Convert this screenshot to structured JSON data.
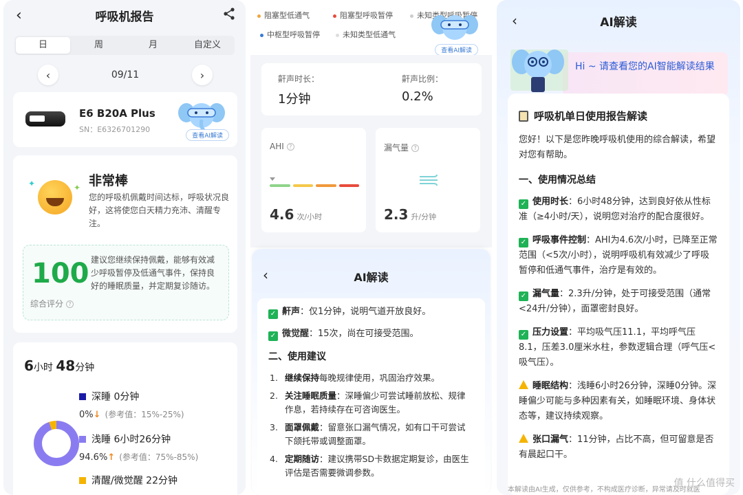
{
  "panel1": {
    "title": "呼吸机报告",
    "tabs": [
      "日",
      "周",
      "月",
      "自定义"
    ],
    "date": "09/11",
    "device": {
      "name": "E6 B20A Plus",
      "sn": "SN：E6326701290",
      "ai_button": "查看AI解读"
    },
    "verdict": {
      "title": "非常棒",
      "desc": "您的呼吸机佩戴时间达标，呼吸状况良好，这将使您白天精力充沛、清醒专注。"
    },
    "score": {
      "value": "100",
      "label": "综合评分",
      "advice": "建议您继续保持佩戴，能够有效减少呼吸暂停及低通气事件，保持良好的睡眠质量，并定期复诊随访。"
    },
    "sleep": {
      "hours": "6",
      "hours_unit": "小时",
      "minutes": "48",
      "minutes_unit": "分钟",
      "stages": [
        {
          "name": "深睡 0分钟",
          "pct": "0%",
          "trend": "down",
          "ref": "(参考值：15%-25%)",
          "color": "#1a1aa8"
        },
        {
          "name": "浅睡 6小时26分钟",
          "pct": "94.6%",
          "trend": "up",
          "ref": "(参考值：75%-85%)",
          "color": "#8a7cf0"
        },
        {
          "name": "清醒/微觉醒 22分钟",
          "color": "#f5b400"
        }
      ],
      "donut_fractions": [
        0.0,
        0.946,
        0.054
      ]
    }
  },
  "panel2": {
    "legend": [
      {
        "label": "阻塞型低通气",
        "color": "#f0a640"
      },
      {
        "label": "阻塞型呼吸暂停",
        "color": "#e84b3c"
      },
      {
        "label": "未知类型呼吸暂停",
        "color": "#cccccc"
      },
      {
        "label": "中枢型呼吸暂停",
        "color": "#3a7bd5"
      },
      {
        "label": "未知类型低通气",
        "color": "#dddddd"
      }
    ],
    "ai_button": "查看AI解读",
    "snore_time_label": "鼾声时长：",
    "snore_time_value": "1分钟",
    "snore_ratio_label": "鼾声比例：",
    "snore_ratio_value": "0.2%",
    "ahi_label": "AHI",
    "ahi_value": "4.6",
    "ahi_unit": "次/小时",
    "leak_label": "漏气量",
    "leak_value": "2.3",
    "leak_unit": "升/分钟",
    "sheet_title": "AI解读",
    "lines": [
      {
        "key": "鼾声",
        "text": "：仅1分钟，说明气道开放良好。"
      },
      {
        "key": "微觉醒",
        "text": "：15次，尚在可接受范围。"
      }
    ],
    "section": "二、使用建议",
    "advice": [
      {
        "n": "1.",
        "key": "继续保持",
        "text": "每晚规律使用，巩固治疗效果。"
      },
      {
        "n": "2.",
        "key": "关注睡眠质量",
        "text": "：深睡偏少可尝试睡前放松、规律作息，若持续存在可咨询医生。"
      },
      {
        "n": "3.",
        "key": "面罩佩戴",
        "text": "：留意张口漏气情况，如有口干可尝试下颌托带或调整面罩。"
      },
      {
        "n": "4.",
        "key": "定期随访",
        "text": "：建议携带SD卡数据定期复诊，由医生评估是否需要微调参数。"
      }
    ]
  },
  "panel3": {
    "title": "AI解读",
    "greeting": "Hi ~ 请查看您的AI智能解读结果",
    "report_title": "呼吸机单日使用报告解读",
    "intro": "您好！以下是您昨晚呼吸机使用的综合解读，希望对您有帮助。",
    "section": "一、使用情况总结",
    "items": [
      {
        "icon": "check",
        "key": "使用时长",
        "text": "：6小时48分钟，达到良好依从性标准（≥4小时/天），说明您对治疗的配合度很好。"
      },
      {
        "icon": "check",
        "key": "呼吸事件控制",
        "text": "：AHI为4.6次/小时，已降至正常范围（<5次/小时），说明呼吸机有效减少了呼吸暂停和低通气事件，治疗是有效的。"
      },
      {
        "icon": "check",
        "key": "漏气量",
        "text": "：2.3升/分钟，处于可接受范围（通常<24升/分钟），面罩密封良好。"
      },
      {
        "icon": "check",
        "key": "压力设置",
        "text": "：平均吸气压11.1，平均呼气压8.1，压差3.0厘米水柱，参数逻辑合理（呼气压<吸气压）。"
      },
      {
        "icon": "warn",
        "key": "睡眠结构",
        "text": "：浅睡6小时26分钟，深睡0分钟。深睡偏少可能与多种因素有关，如睡眠环境、身体状态等，建议持续观察。"
      },
      {
        "icon": "warn",
        "key": "张口漏气",
        "text": "：11分钟，占比不高，但可留意是否有晨起口干。"
      }
    ],
    "footnote": "本解读由AI生成，仅供参考，不构成医疗诊断，异常请及时就医",
    "watermark": "值 什么值得买"
  }
}
